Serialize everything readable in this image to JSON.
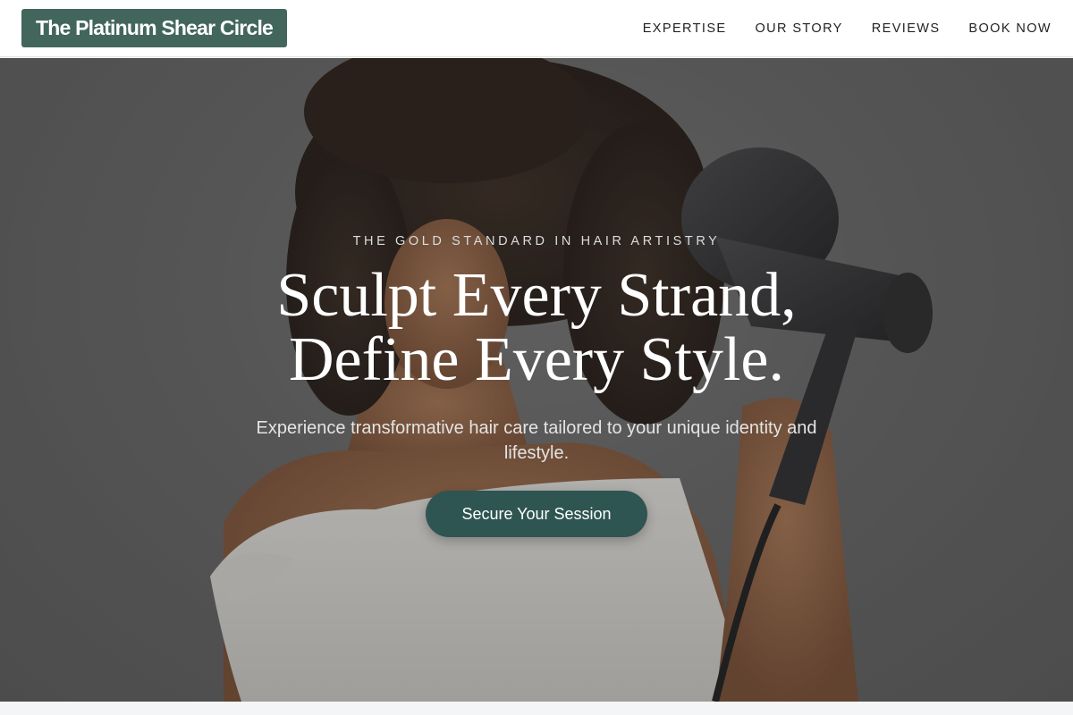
{
  "brand": {
    "name": "The Platinum Shear Circle"
  },
  "nav": {
    "items": [
      {
        "label": "EXPERTISE"
      },
      {
        "label": "OUR STORY"
      },
      {
        "label": "REVIEWS"
      },
      {
        "label": "BOOK NOW"
      }
    ]
  },
  "hero": {
    "eyebrow": "THE GOLD STANDARD IN HAIR ARTISTRY",
    "headline_line1": "Sculpt Every Strand,",
    "headline_line2": "Define Every Style.",
    "subtext": "Experience transformative hair care tailored to your unique identity and lifestyle.",
    "cta_label": "Secure Your Session",
    "image_subject": "woman-with-curly-hair-holding-hair-dryer"
  },
  "colors": {
    "brand_green": "#43665c",
    "cta_teal": "#2f5552",
    "nav_text": "#222222"
  }
}
